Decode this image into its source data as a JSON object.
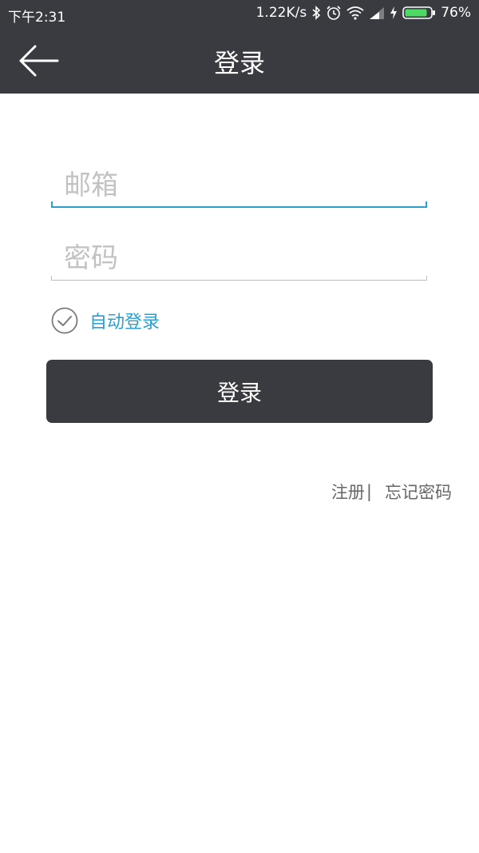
{
  "status_bar": {
    "time": "下午2:31",
    "network_speed": "1.22K/s",
    "battery": "76%",
    "icons": [
      "bluetooth-icon",
      "alarm-icon",
      "wifi-icon",
      "signal-icon",
      "charging-icon",
      "battery-icon"
    ]
  },
  "app_bar": {
    "title": "登录",
    "back_icon": "back-arrow-icon"
  },
  "form": {
    "email_placeholder": "邮箱",
    "email_value": "",
    "password_placeholder": "密码",
    "password_value": "",
    "auto_login_label": "自动登录",
    "auto_login_checked": true,
    "login_button": "登录"
  },
  "links": {
    "register": "注册",
    "separator": "|",
    "forgot_password": "忘记密码"
  },
  "colors": {
    "bar_bg": "#3a3b41",
    "accent": "#2a9fd0",
    "link_gray": "#666666"
  }
}
